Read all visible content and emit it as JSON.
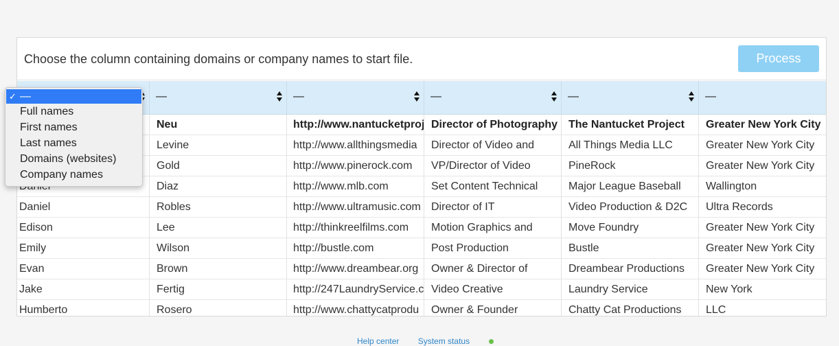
{
  "header": {
    "instructions": "Choose the column containing domains or company names to start file.",
    "process_label": "Process"
  },
  "column_selects": [
    "—",
    "—",
    "—",
    "—",
    "—",
    "—"
  ],
  "dropdown": {
    "selected": "—",
    "check": "✓",
    "options": [
      "Full names",
      "First names",
      "Last names",
      "Domains (websites)",
      "Company names"
    ]
  },
  "rows": [
    [
      "",
      "Neu",
      "http://www.nantucketproje",
      "Director of Photography",
      "The Nantucket Project",
      "Greater New York City"
    ],
    [
      "",
      "Levine",
      "http://www.allthingsmedia",
      "Director of Video and",
      "All Things Media LLC",
      "Greater New York City"
    ],
    [
      "",
      "Gold",
      "http://www.pinerock.com",
      "VP/Director of Video",
      "PineRock",
      "Greater New York City"
    ],
    [
      "Daniel",
      "Diaz",
      "http://www.mlb.com",
      "Set Content Technical",
      "Major League Baseball",
      "Wallington"
    ],
    [
      "Daniel",
      "Robles",
      "http://www.ultramusic.com",
      "Director of IT",
      "Video Production & D2C",
      "Ultra Records"
    ],
    [
      "Edison",
      "Lee",
      "http://thinkreelfilms.com",
      "Motion Graphics and",
      "Move Foundry",
      "Greater New York City"
    ],
    [
      "Emily",
      "Wilson",
      "http://bustle.com",
      "Post Production",
      "Bustle",
      "Greater New York City"
    ],
    [
      "Evan",
      "Brown",
      "http://www.dreambear.org",
      "Owner & Director of",
      "Dreambear Productions",
      "Greater New York City"
    ],
    [
      "Jake",
      "Fertig",
      "http://247LaundryService.c",
      "Video Creative",
      "Laundry Service",
      "New York"
    ],
    [
      "Humberto",
      "Rosero",
      "http://www.chattycatprodu",
      "Owner & Founder",
      "Chatty Cat Productions",
      "LLC"
    ]
  ],
  "footer": {
    "help_center": "Help center",
    "system_status": "System status"
  }
}
